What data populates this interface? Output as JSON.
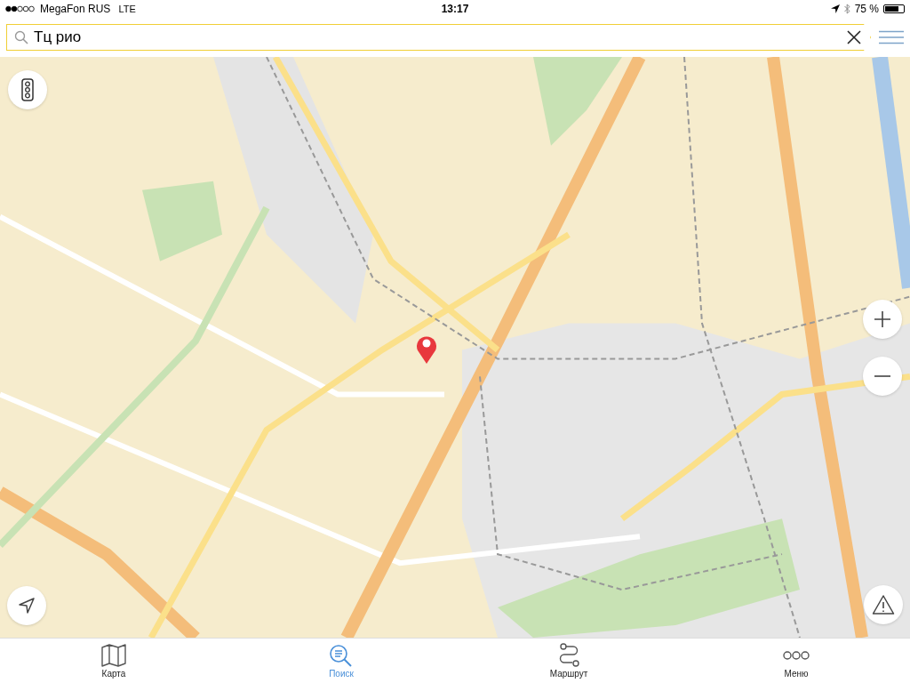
{
  "status_bar": {
    "carrier": "MegaFon RUS",
    "network": "LTE",
    "time": "13:17",
    "battery": "75 %"
  },
  "search": {
    "value": "Тц рио"
  },
  "tabs": [
    {
      "label": "Карта",
      "kind": "map",
      "selected": false
    },
    {
      "label": "Поиск",
      "kind": "search",
      "selected": true
    },
    {
      "label": "Маршрут",
      "kind": "route",
      "selected": false
    },
    {
      "label": "Меню",
      "kind": "more",
      "selected": false
    }
  ]
}
